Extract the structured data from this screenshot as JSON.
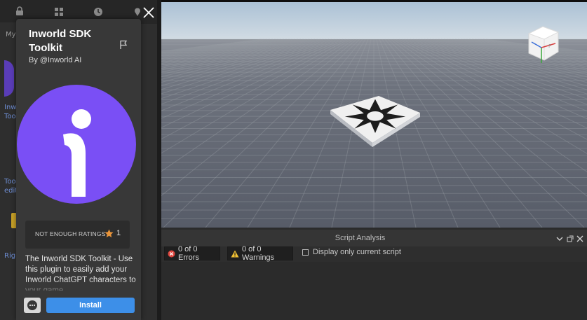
{
  "left_sidebar": {
    "tabs": [
      {
        "icon": "lock-icon"
      },
      {
        "icon": "grid-icon"
      },
      {
        "icon": "clock-icon"
      },
      {
        "icon": "pin-icon"
      }
    ],
    "peek_texts": [
      "My",
      "Inw",
      "Too",
      "Too",
      "edit",
      "Rig"
    ]
  },
  "plugin_popup": {
    "title": "Inworld SDK Toolkit",
    "byline": "By @Inworld AI",
    "ratings_label": "NOT ENOUGH RATINGS",
    "rating_count": "1",
    "description": "The Inworld SDK Toolkit - Use this plugin to easily add your Inworld ChatGPT characters to your game",
    "install_label": "Install",
    "logo_color": "#7a4ff5",
    "install_color": "#3d8fe8"
  },
  "viewport": {
    "sky_top": "#aec3d6",
    "ground": "#5a5f6b"
  },
  "script_analysis": {
    "title": "Script Analysis",
    "errors_label": "0 of 0 Errors",
    "warnings_label": "0 of 0 Warnings",
    "display_only_label": "Display only current script"
  }
}
